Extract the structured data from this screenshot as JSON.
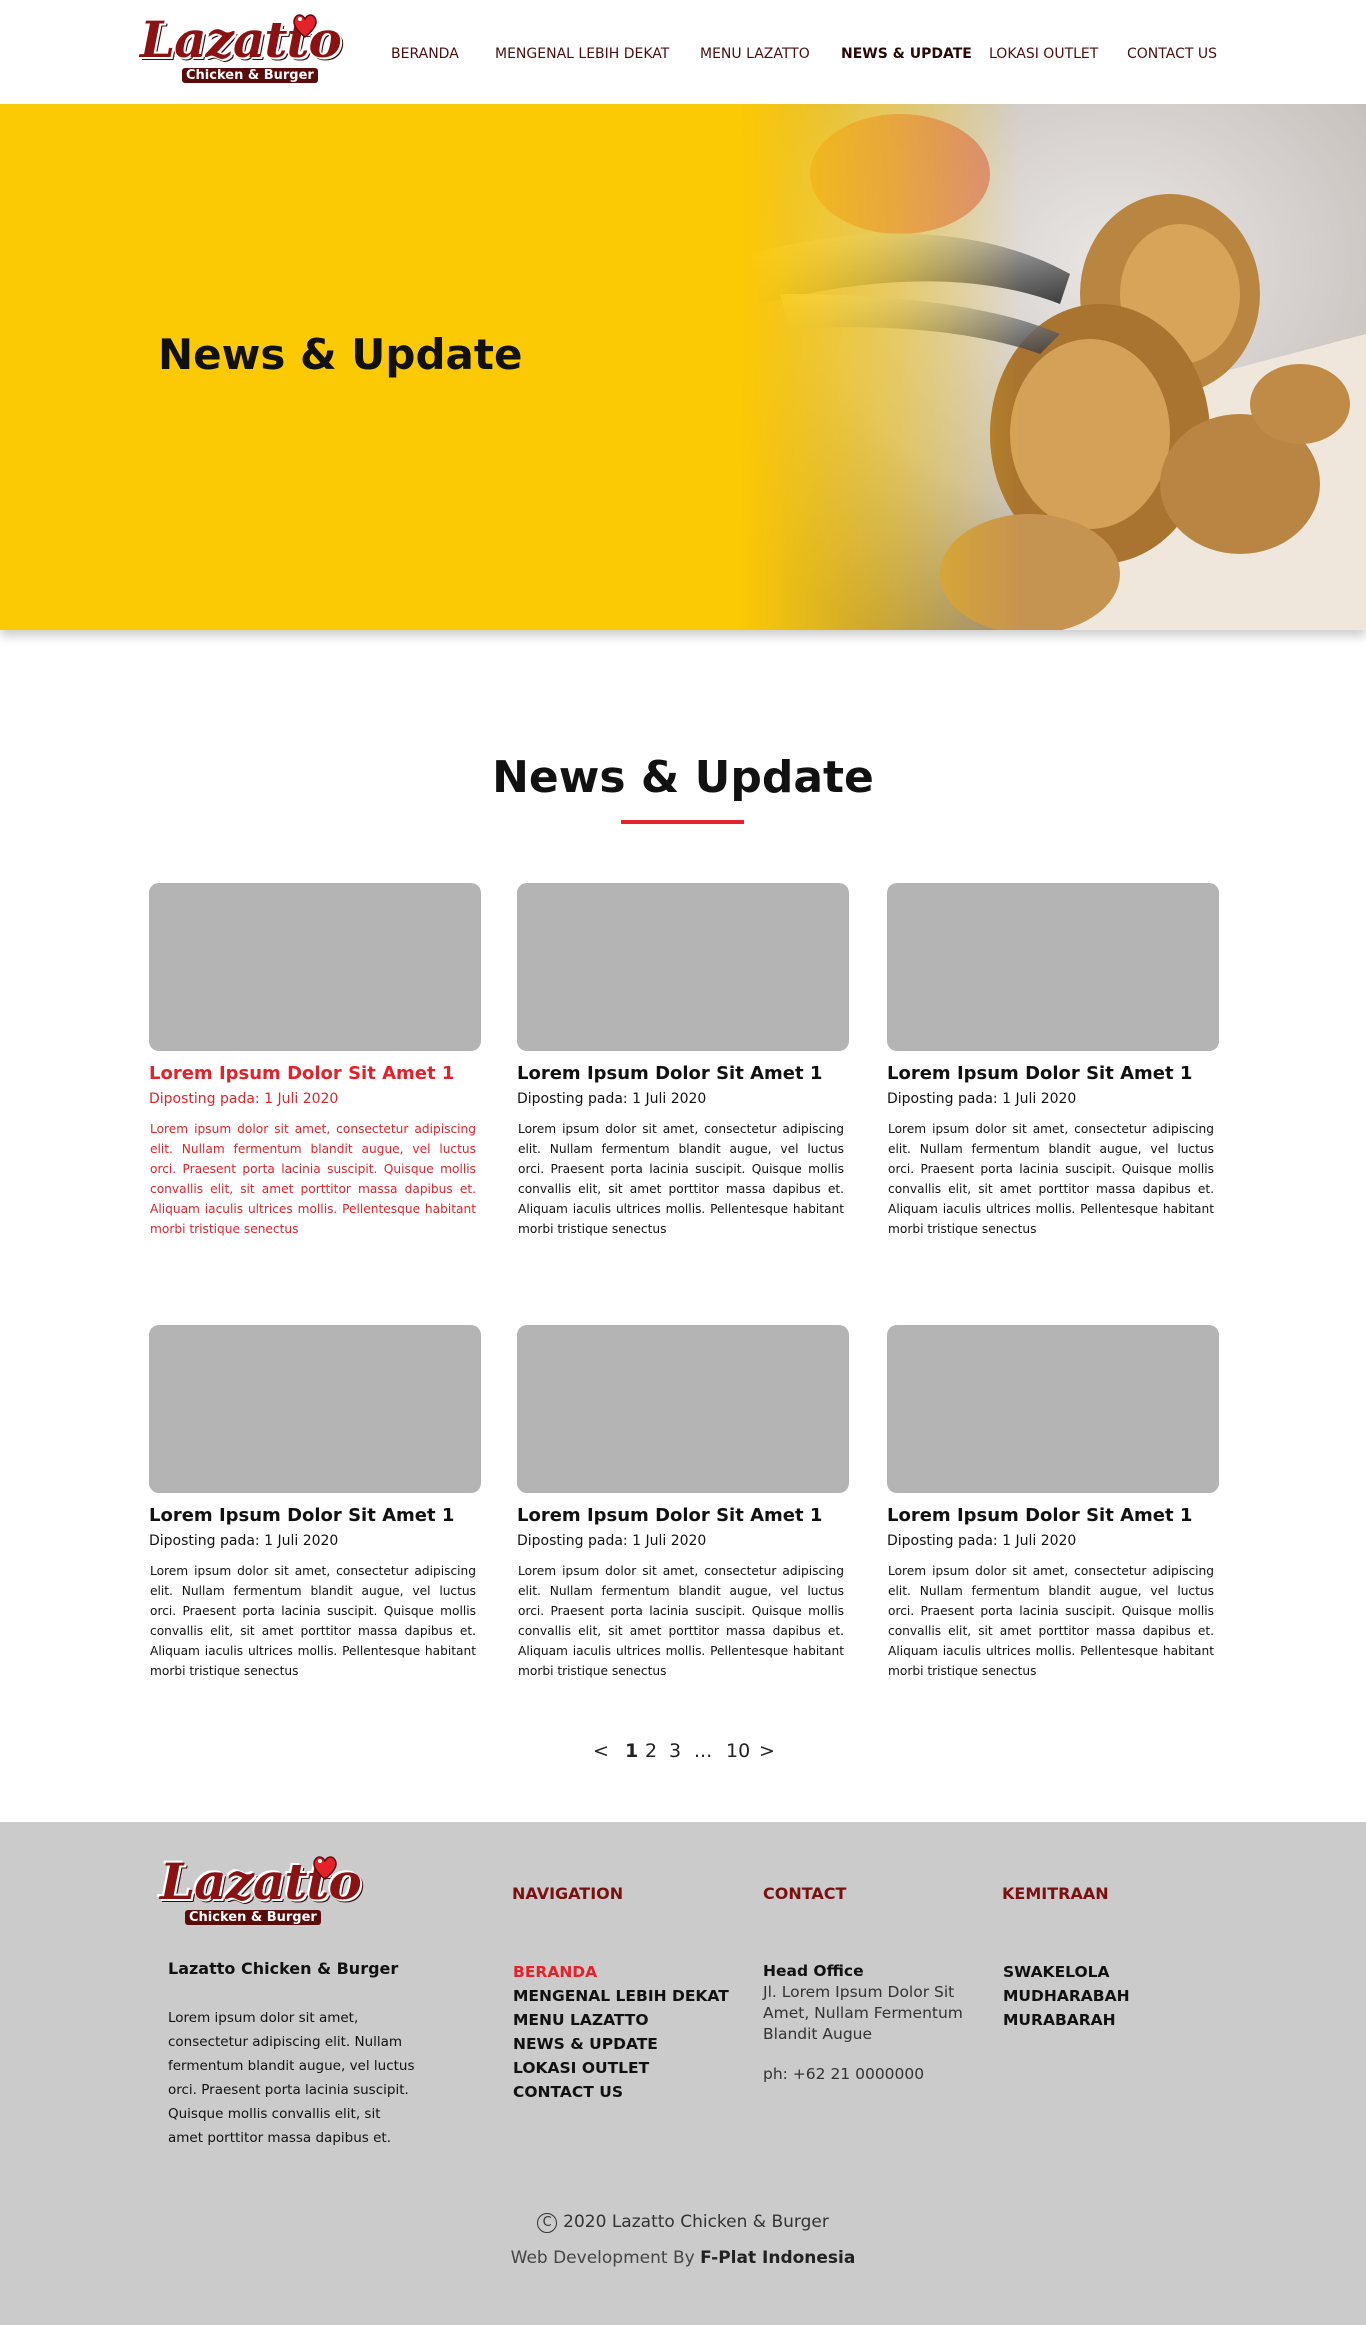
{
  "header": {
    "logo_text": "Lazatto",
    "logo_sub": "Chicken & Burger",
    "nav": [
      {
        "label": "BERANDA",
        "active": false
      },
      {
        "label": "MENGENAL LEBIH DEKAT",
        "active": false
      },
      {
        "label": "MENU LAZATTO",
        "active": false
      },
      {
        "label": "NEWS & UPDATE",
        "active": true
      },
      {
        "label": "LOKASI OUTLET",
        "active": false
      },
      {
        "label": "CONTACT US",
        "active": false
      }
    ]
  },
  "hero": {
    "title": "News & Update"
  },
  "section": {
    "title": "News & Update"
  },
  "cards": [
    {
      "title": "Lorem Ipsum Dolor Sit Amet 1",
      "date": "Diposting pada: 1 Juli 2020",
      "body": "Lorem ipsum dolor sit amet, consectetur adipiscing elit. Nullam fermentum blandit augue, vel luctus orci. Praesent porta lacinia suscipit. Quisque mollis convallis elit, sit amet porttitor massa dapibus et. Aliquam iaculis ultrices mollis. Pellentesque habitant morbi tristique senectus",
      "highlighted": true
    },
    {
      "title": "Lorem Ipsum Dolor Sit Amet 1",
      "date": "Diposting pada: 1 Juli 2020",
      "body": "Lorem ipsum dolor sit amet, consectetur adipiscing elit. Nullam fermentum blandit augue, vel luctus orci. Praesent porta lacinia suscipit. Quisque mollis convallis elit, sit amet porttitor massa dapibus et. Aliquam iaculis ultrices mollis. Pellentesque habitant morbi tristique senectus",
      "highlighted": false
    },
    {
      "title": "Lorem Ipsum Dolor Sit Amet 1",
      "date": "Diposting pada: 1 Juli 2020",
      "body": "Lorem ipsum dolor sit amet, consectetur adipiscing elit. Nullam fermentum blandit augue, vel luctus orci. Praesent porta lacinia suscipit. Quisque mollis convallis elit, sit amet porttitor massa dapibus et. Aliquam iaculis ultrices mollis. Pellentesque habitant morbi tristique senectus",
      "highlighted": false
    },
    {
      "title": "Lorem Ipsum Dolor Sit Amet 1",
      "date": "Diposting pada: 1 Juli 2020",
      "body": "Lorem ipsum dolor sit amet, consectetur adipiscing elit. Nullam fermentum blandit augue, vel luctus orci. Praesent porta lacinia suscipit. Quisque mollis convallis elit, sit amet porttitor massa dapibus et. Aliquam iaculis ultrices mollis. Pellentesque habitant morbi tristique senectus",
      "highlighted": false
    },
    {
      "title": "Lorem Ipsum Dolor Sit Amet 1",
      "date": "Diposting pada: 1 Juli 2020",
      "body": "Lorem ipsum dolor sit amet, consectetur adipiscing elit. Nullam fermentum blandit augue, vel luctus orci. Praesent porta lacinia suscipit. Quisque mollis convallis elit, sit amet porttitor massa dapibus et. Aliquam iaculis ultrices mollis. Pellentesque habitant morbi tristique senectus",
      "highlighted": false
    },
    {
      "title": "Lorem Ipsum Dolor Sit Amet 1",
      "date": "Diposting pada: 1 Juli 2020",
      "body": "Lorem ipsum dolor sit amet, consectetur adipiscing elit. Nullam fermentum blandit augue, vel luctus orci. Praesent porta lacinia suscipit. Quisque mollis convallis elit, sit amet porttitor massa dapibus et. Aliquam iaculis ultrices mollis. Pellentesque habitant morbi tristique senectus",
      "highlighted": false
    }
  ],
  "pagination": {
    "prev": "<",
    "pages": [
      "1",
      "2",
      "3"
    ],
    "ellipsis": "...",
    "last": "10",
    "next": ">",
    "current": "1"
  },
  "footer": {
    "logo_text": "Lazatto",
    "logo_sub": "Chicken & Burger",
    "company": "Lazatto Chicken & Burger",
    "about": "Lorem ipsum dolor sit amet, consectetur adipiscing elit. Nullam fermentum blandit augue, vel luctus orci. Praesent porta lacinia suscipit. Quisque mollis convallis elit, sit amet porttitor massa dapibus et.",
    "nav_heading": "NAVIGATION",
    "nav_items": [
      "BERANDA",
      "MENGENAL LEBIH DEKAT",
      "MENU LAZATTO",
      "NEWS & UPDATE",
      "LOKASI OUTLET",
      "CONTACT US"
    ],
    "contact_heading": "CONTACT",
    "contact_office": "Head Office",
    "contact_address": "Jl. Lorem Ipsum Dolor Sit Amet, Nullam Fermentum Blandit Augue",
    "contact_phone": "ph: +62 21 0000000",
    "partner_heading": "KEMITRAAN",
    "partner_items": [
      "SWAKELOLA",
      "MUDHARABAH",
      "MURABARAH"
    ],
    "copyright_symbol": "C",
    "copyright": "2020 Lazatto Chicken & Burger",
    "webdev_prefix": "Web Development By",
    "webdev_name": "F-Plat Indonesia"
  },
  "colors": {
    "accent": "#e5222a",
    "hero_yellow": "#fcc905",
    "brand_maroon": "#7a1010",
    "footer_bg": "#cbcbcb",
    "thumb_gray": "#b4b4b4"
  },
  "icons": [
    "heart-logo-icon",
    "copyright-icon"
  ]
}
